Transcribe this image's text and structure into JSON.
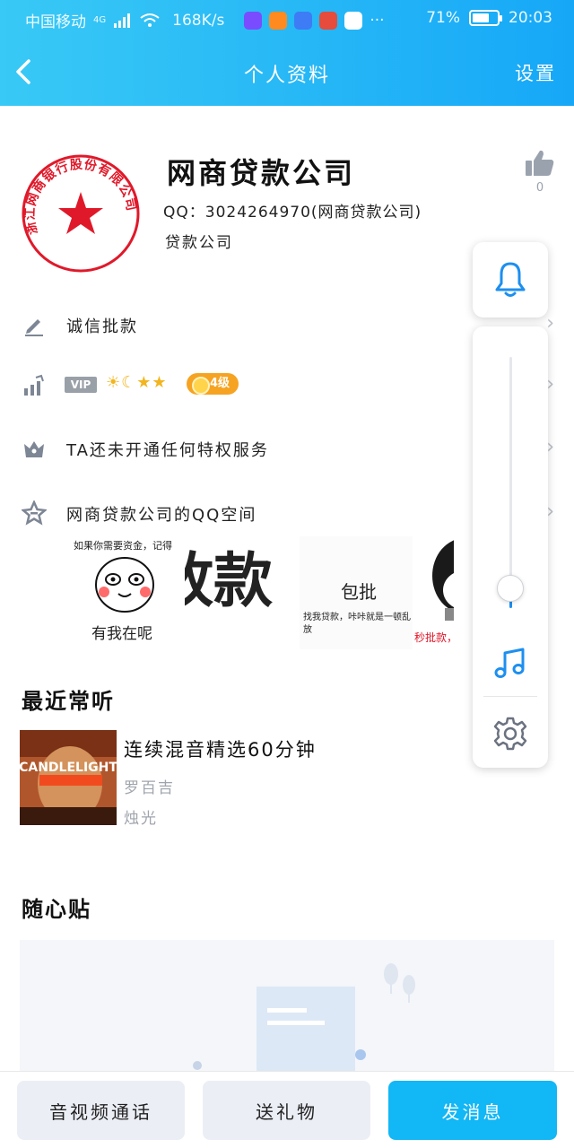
{
  "status_bar": {
    "carrier": "中国移动",
    "network": "4G",
    "speed": "168K/s",
    "battery": "71%",
    "battery_level": 0.71,
    "time": "20:03",
    "more": "···"
  },
  "header": {
    "title": "个人资料",
    "settings_label": "设置"
  },
  "profile": {
    "name": "网商贷款公司",
    "qq": "QQ：3024264970(网商贷款公司)",
    "tagline": "贷款公司",
    "like_count": "0",
    "avatar_seal_text": "浙江网商银行股份有限公司"
  },
  "rows": [
    {
      "key": "signature",
      "label": "诚信批款"
    },
    {
      "key": "vip",
      "vip_badge": "VIP",
      "level_pill": "4级"
    },
    {
      "key": "privilege",
      "label": "TA还未开通任何特权服务"
    },
    {
      "key": "qzone",
      "label": "网商贷款公司的QQ空间"
    }
  ],
  "photos": {
    "p1_top": "如果你需要资金，记得",
    "p1_bottom": "有我在呢",
    "p2_text": "放款",
    "p3_title": "包批",
    "p3_sub": "找我贷款，咔咔就是一顿乱放",
    "p4_text": "秒批款，"
  },
  "music": {
    "section_title": "最近常听",
    "song_title": "连续混音精选60分钟",
    "artist": "罗百吉",
    "album": "烛光",
    "album_art_text": "CANDLELIGHT"
  },
  "sticky": {
    "section_title": "随心贴"
  },
  "bottom": {
    "call_label": "音视频通话",
    "gift_label": "送礼物",
    "message_label": "发消息"
  },
  "float_panel": {
    "volume_level": 0.08
  },
  "colors": {
    "header_start": "#39c9f6",
    "header_end": "#16a8f7",
    "primary": "#12b7f5",
    "accent_blue": "#1d8ff0",
    "vip_gold": "#f6a322"
  }
}
